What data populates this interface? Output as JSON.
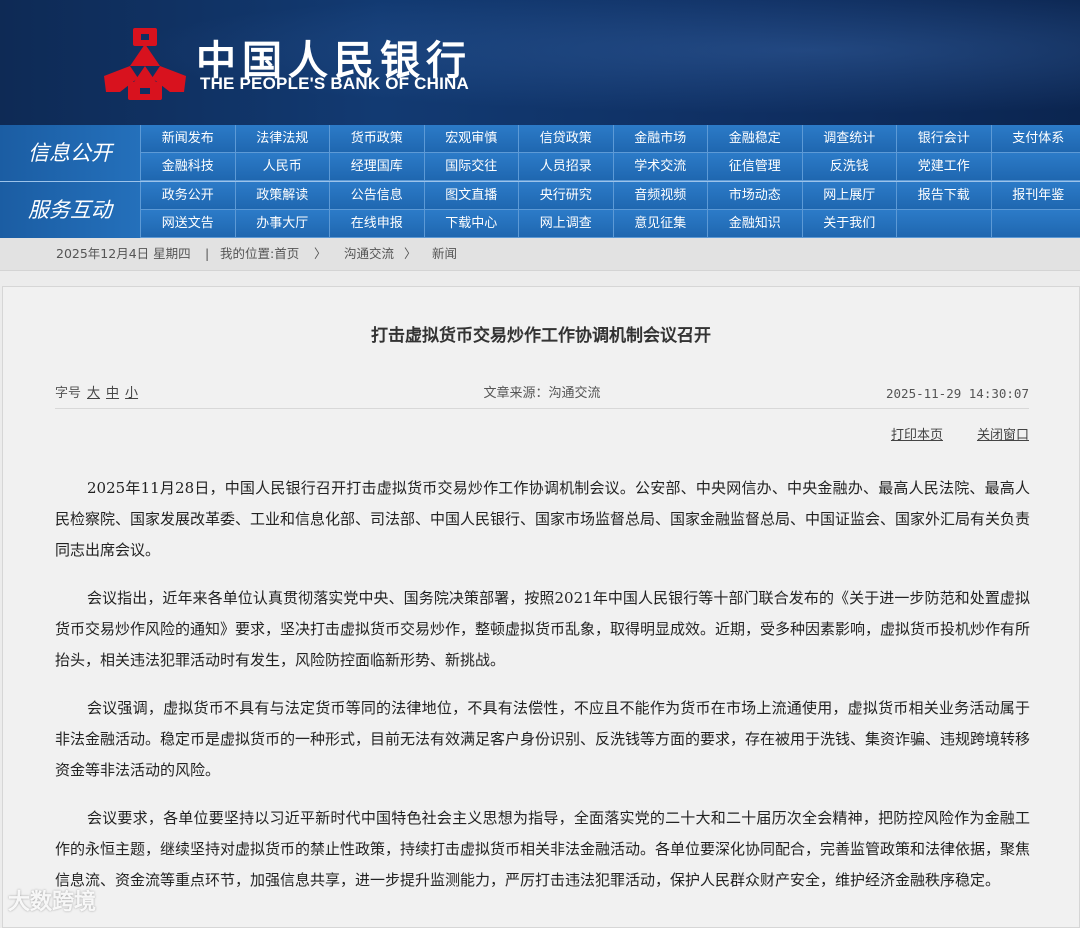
{
  "header": {
    "title_cn": "中国人民银行",
    "title_en": "THE PEOPLE'S BANK OF CHINA",
    "brand_color": "#0f2f62",
    "logo_color": "#d8121e"
  },
  "nav": {
    "section1_label": "信息公开",
    "section1_items": [
      "新闻发布",
      "法律法规",
      "货币政策",
      "宏观审慎",
      "信贷政策",
      "金融市场",
      "金融稳定",
      "调查统计",
      "银行会计",
      "支付体系",
      "金融科技",
      "人民币",
      "经理国库",
      "国际交往",
      "人员招录",
      "学术交流",
      "征信管理",
      "反洗钱",
      "党建工作",
      ""
    ],
    "section2_label": "服务互动",
    "section2_items": [
      "政务公开",
      "政策解读",
      "公告信息",
      "图文直播",
      "央行研究",
      "音频视频",
      "市场动态",
      "网上展厅",
      "报告下载",
      "报刊年鉴",
      "网送文告",
      "办事大厅",
      "在线申报",
      "下载中心",
      "网上调查",
      "意见征集",
      "金融知识",
      "关于我们",
      "",
      ""
    ]
  },
  "breadcrumb": {
    "date": "2025年12月4日  星期四",
    "sep": "|",
    "location": "我的位置:首页",
    "arrow1": "〉",
    "item1": "沟通交流",
    "arrow2": "〉",
    "item2": "新闻"
  },
  "article": {
    "title": "打击虚拟货币交易炒作工作协调机制会议召开",
    "font_label": "字号",
    "font_large": "大",
    "font_medium": "中",
    "font_small": "小",
    "source": "文章来源：沟通交流",
    "date": "2025-11-29 14:30:07",
    "print_label": "打印本页",
    "close_label": "关闭窗口",
    "paragraphs": [
      "2025年11月28日，中国人民银行召开打击虚拟货币交易炒作工作协调机制会议。公安部、中央网信办、中央金融办、最高人民法院、最高人民检察院、国家发展改革委、工业和信息化部、司法部、中国人民银行、国家市场监督总局、国家金融监督总局、中国证监会、国家外汇局有关负责同志出席会议。",
      "会议指出，近年来各单位认真贯彻落实党中央、国务院决策部署，按照2021年中国人民银行等十部门联合发布的《关于进一步防范和处置虚拟货币交易炒作风险的通知》要求，坚决打击虚拟货币交易炒作，整顿虚拟货币乱象，取得明显成效。近期，受多种因素影响，虚拟货币投机炒作有所抬头，相关违法犯罪活动时有发生，风险防控面临新形势、新挑战。",
      "会议强调，虚拟货币不具有与法定货币等同的法律地位，不具有法偿性，不应且不能作为货币在市场上流通使用，虚拟货币相关业务活动属于非法金融活动。稳定币是虚拟货币的一种形式，目前无法有效满足客户身份识别、反洗钱等方面的要求，存在被用于洗钱、集资诈骗、违规跨境转移资金等非法活动的风险。",
      "会议要求，各单位要坚持以习近平新时代中国特色社会主义思想为指导，全面落实党的二十大和二十届历次全会精神，把防控风险作为金融工作的永恒主题，继续坚持对虚拟货币的禁止性政策，持续打击虚拟货币相关非法金融活动。各单位要深化协同配合，完善监管政策和法律依据，聚焦信息流、资金流等重点环节，加强信息共享，进一步提升监测能力，严厉打击违法犯罪活动，保护人民群众财产安全，维护经济金融秩序稳定。"
    ]
  },
  "watermark": "大数跨境"
}
